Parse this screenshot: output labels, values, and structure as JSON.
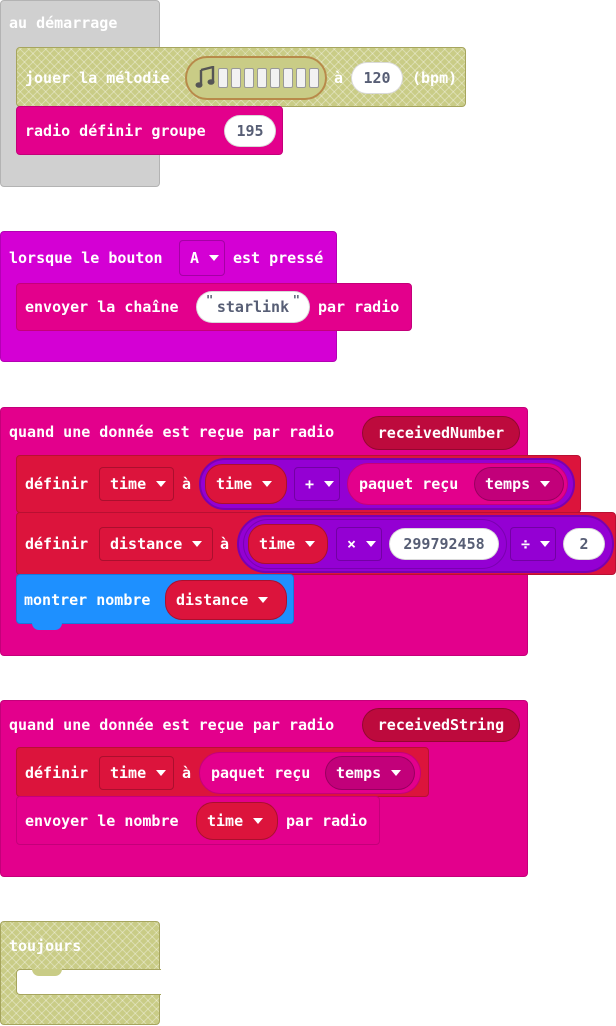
{
  "on_start": {
    "hat": "au démarrage",
    "play_melody": {
      "label": "jouer la mélodie",
      "connector": "à",
      "tempo": "120",
      "unit": "(bpm)",
      "icon": "music-note-icon"
    },
    "radio_group": {
      "label": "radio définir groupe",
      "value": "195"
    }
  },
  "on_button": {
    "hat_label": "lorsque le bouton",
    "button": "A",
    "hat_suffix": "est pressé",
    "send_string": {
      "label": "envoyer la chaîne",
      "value": "starlink",
      "suffix": "par radio"
    }
  },
  "on_received_number": {
    "hat": "quand une donnée est reçue par radio",
    "param": "receivedNumber",
    "set_time": {
      "label": "définir",
      "var": "time",
      "connector": "à",
      "operand": "time",
      "op": "+",
      "packet_label": "paquet reçu",
      "packet_field": "temps"
    },
    "set_distance": {
      "label": "définir",
      "var": "distance",
      "connector": "à",
      "operand": "time",
      "op1": "×",
      "number": "299792458",
      "op2": "÷",
      "divisor": "2"
    },
    "show_number": {
      "label": "montrer nombre",
      "value": "distance"
    }
  },
  "on_received_string": {
    "hat": "quand une donnée est reçue par radio",
    "param": "receivedString",
    "set_time": {
      "label": "définir",
      "var": "time",
      "connector": "à",
      "packet_label": "paquet reçu",
      "packet_field": "temps"
    },
    "send_number": {
      "label": "envoyer le nombre",
      "value": "time",
      "suffix": "par radio"
    }
  },
  "forever": {
    "hat": "toujours"
  },
  "colors": {
    "radio": "#e3008c",
    "input": "#d400d4",
    "variables": "#dc143c",
    "math": "#9400d3",
    "basic": "#1e90ff",
    "start": "#d0d0d0",
    "music_loops": "#c9cc86"
  }
}
